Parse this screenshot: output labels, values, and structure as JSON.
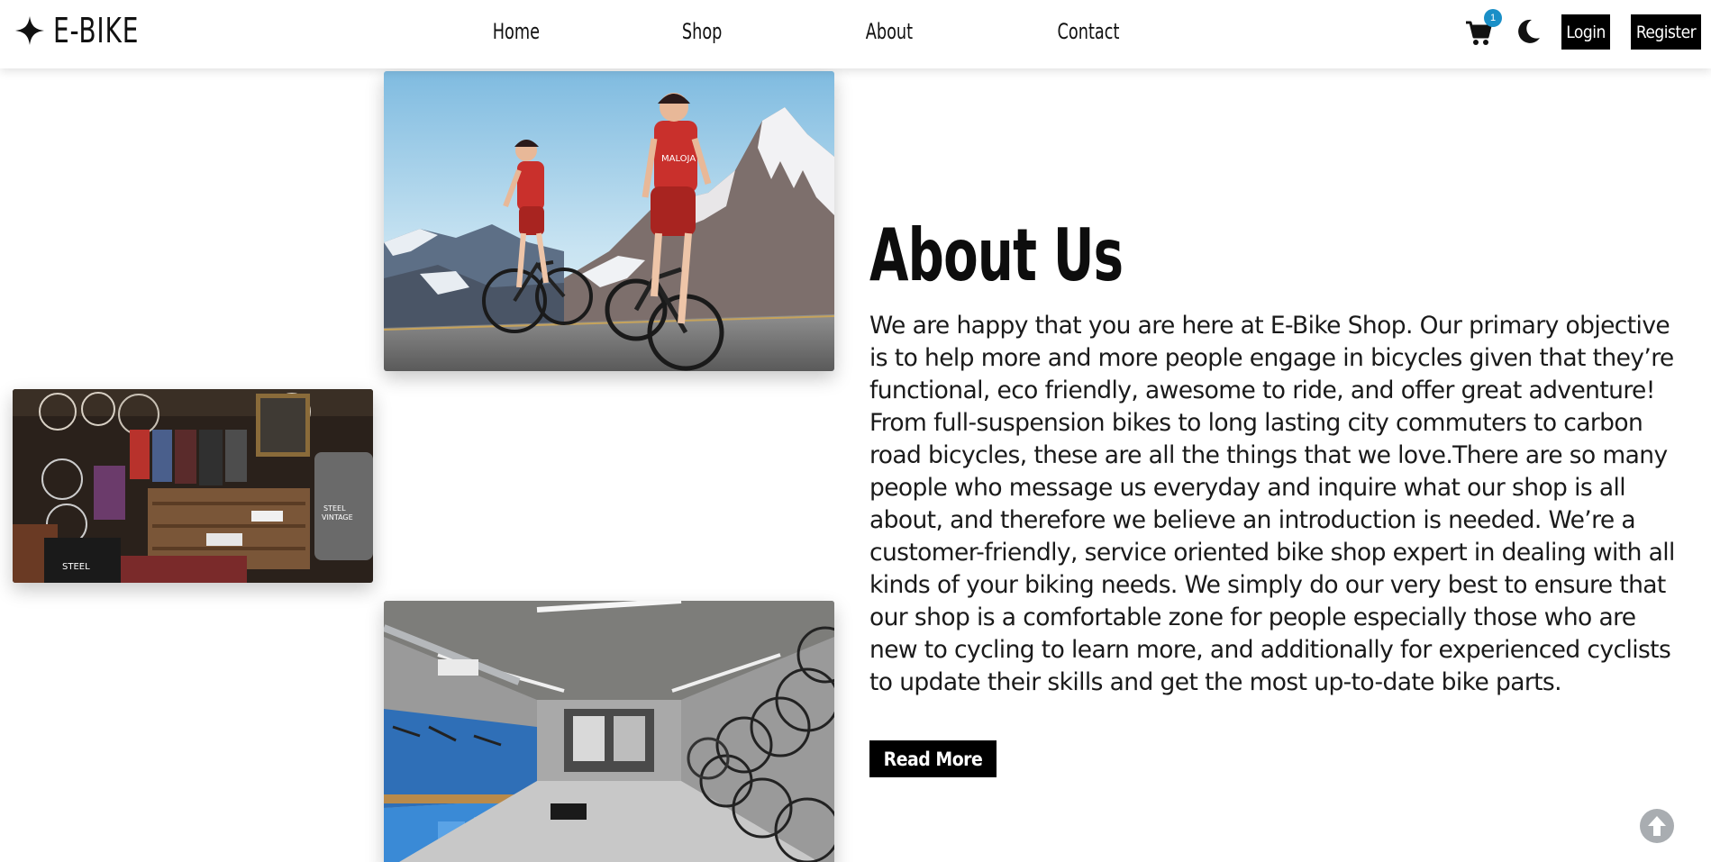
{
  "header": {
    "logo_text": "E-BIKE",
    "nav": [
      "Home",
      "Shop",
      "About",
      "Contact"
    ],
    "cart_count": "1",
    "login_label": "Login",
    "register_label": "Register"
  },
  "about": {
    "title": "About Us",
    "body": "We are happy that you are here at E-Bike Shop. Our primary objective is to help more and more people engage in bicycles given that they’re functional, eco friendly, awesome to ride, and offer great adventure! From full-suspension bikes to long lasting city commuters to carbon road bicycles, these are all the things that we love.There are so many people who message us everyday and inquire what our shop is all about, and therefore we believe an introduction is needed. We’re a customer-friendly, service oriented bike shop expert in dealing with all kinds of your biking needs. We simply do our very best to ensure that our shop is a comfortable zone for people especially those who are new to cycling to learn more, and additionally for experienced cyclists to update their skills and get the most up-to-date bike parts.",
    "read_more_label": "Read More"
  },
  "icons": {
    "logo": "sparkle-star-icon",
    "cart": "shopping-cart-icon",
    "theme": "moon-icon",
    "scroll_top": "arrow-up-circle-icon"
  },
  "colors": {
    "accent": "#1a8fc7",
    "button": "#000000"
  }
}
